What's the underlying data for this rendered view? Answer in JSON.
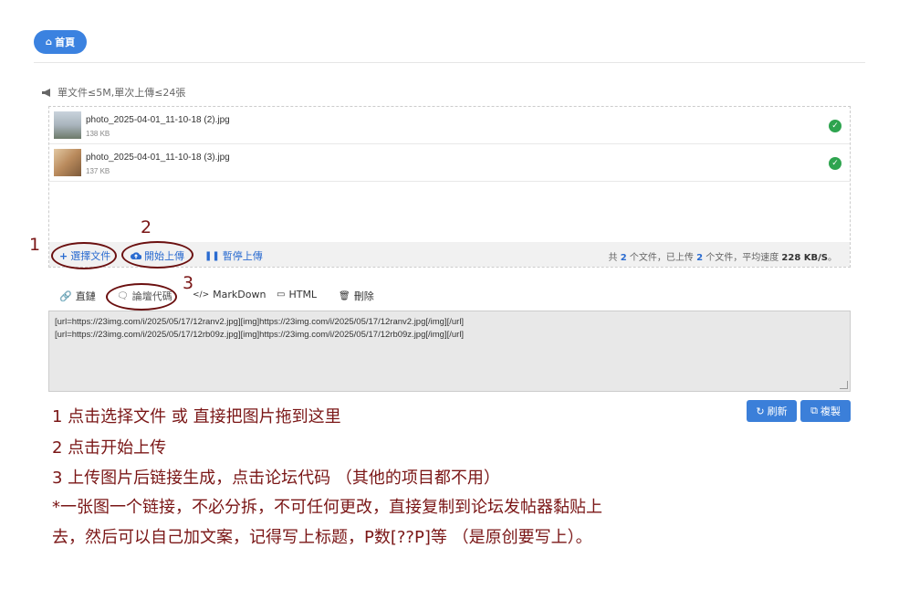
{
  "nav": {
    "home_label": "首頁"
  },
  "notice": {
    "text": "單文件≤5M,單次上傳≤24張"
  },
  "files": [
    {
      "name": "photo_2025-04-01_11-10-18 (2).jpg",
      "size": "138 KB",
      "status": "uploaded"
    },
    {
      "name": "photo_2025-04-01_11-10-18 (3).jpg",
      "size": "137 KB",
      "status": "uploaded"
    }
  ],
  "toolbar": {
    "select_label": "選擇文件",
    "start_label": "開始上傳",
    "pause_label": "暫停上傳",
    "stats_prefix": "共",
    "total": "2",
    "stats_mid1": "个文件，已上传",
    "uploaded": "2",
    "stats_mid2": "个文件，平均速度",
    "speed": "228 KB/S",
    "stats_suffix": "。"
  },
  "tabs": [
    {
      "label": "直鏈",
      "icon": "link-icon"
    },
    {
      "label": "論壇代碼",
      "icon": "comment-icon"
    },
    {
      "label": "MarkDown",
      "icon": "code-icon"
    },
    {
      "label": "HTML",
      "icon": "html5-icon"
    },
    {
      "label": "刪除",
      "icon": "trash-icon"
    }
  ],
  "code_lines": [
    "[url=https://23img.com/i/2025/05/17/12ranv2.jpg][img]https://23img.com/i/2025/05/17/12ranv2.jpg[/img][/url]",
    "[url=https://23img.com/i/2025/05/17/12rb09z.jpg][img]https://23img.com/i/2025/05/17/12rb09z.jpg[/img][/url]"
  ],
  "actions": {
    "refresh_label": "刷新",
    "copy_label": "複製"
  },
  "annotations": {
    "n1": "1",
    "n2": "2",
    "n3": "3"
  },
  "instructions": [
    "1 点击选择文件 或 直接把图片拖到这里",
    "2 点击开始上传",
    "3 上传图片后链接生成，点击论坛代码 （其他的项目都不用）",
    "*一张图一个链接，不必分拆，不可任何更改，直接复制到论坛发帖器黏贴上",
    "去，然后可以自己加文案，记得写上标题，P数[??P]等 （是原创要写上）。"
  ],
  "colors": {
    "accent": "#3b82e0",
    "success": "#2ea44f",
    "annotation": "#7a1616"
  }
}
